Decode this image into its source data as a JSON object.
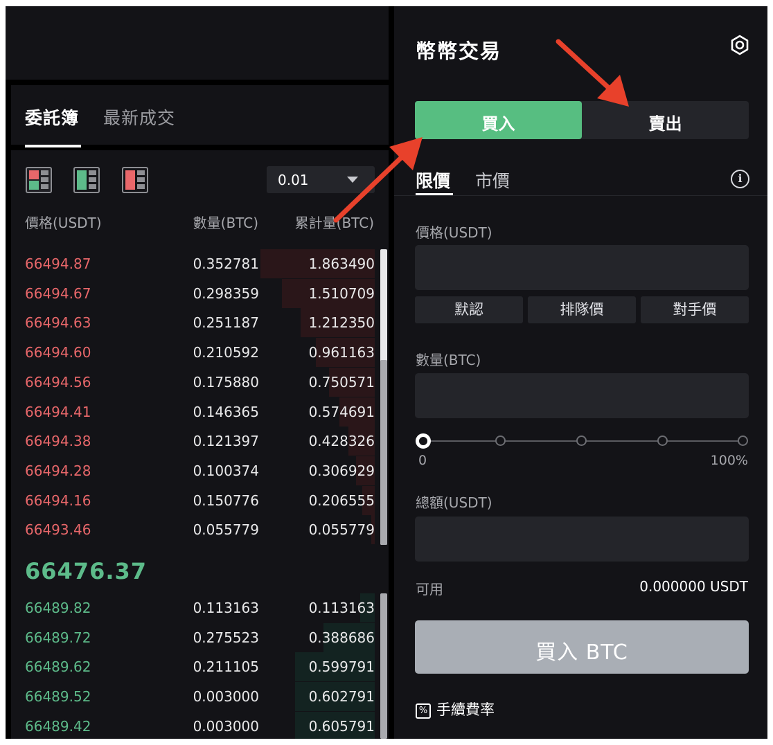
{
  "orderbook": {
    "tabs": [
      "委託簿",
      "最新成交"
    ],
    "tick_size": "0.01",
    "columns": [
      "價格(USDT)",
      "數量(BTC)",
      "累計量(BTC)"
    ],
    "asks": [
      {
        "price": "66494.87",
        "qty": "0.352781",
        "cum": "1.863490",
        "depth": 1.0
      },
      {
        "price": "66494.67",
        "qty": "0.298359",
        "cum": "1.510709",
        "depth": 0.811
      },
      {
        "price": "66494.63",
        "qty": "0.251187",
        "cum": "1.212350",
        "depth": 0.651
      },
      {
        "price": "66494.60",
        "qty": "0.210592",
        "cum": "0.961163",
        "depth": 0.516
      },
      {
        "price": "66494.56",
        "qty": "0.175880",
        "cum": "0.750571",
        "depth": 0.403
      },
      {
        "price": "66494.41",
        "qty": "0.146365",
        "cum": "0.574691",
        "depth": 0.308
      },
      {
        "price": "66494.38",
        "qty": "0.121397",
        "cum": "0.428326",
        "depth": 0.23
      },
      {
        "price": "66494.28",
        "qty": "0.100374",
        "cum": "0.306929",
        "depth": 0.165
      },
      {
        "price": "66494.16",
        "qty": "0.150776",
        "cum": "0.206555",
        "depth": 0.111
      },
      {
        "price": "66493.46",
        "qty": "0.055779",
        "cum": "0.055779",
        "depth": 0.03
      }
    ],
    "last_price": "66476.37",
    "bids": [
      {
        "price": "66489.82",
        "qty": "0.113163",
        "cum": "0.113163",
        "depth": 0.13
      },
      {
        "price": "66489.72",
        "qty": "0.275523",
        "cum": "0.388686",
        "depth": 0.45
      },
      {
        "price": "66489.62",
        "qty": "0.211105",
        "cum": "0.599791",
        "depth": 0.7
      },
      {
        "price": "66489.52",
        "qty": "0.003000",
        "cum": "0.602791",
        "depth": 0.7
      },
      {
        "price": "66489.42",
        "qty": "0.003000",
        "cum": "0.605791",
        "depth": 0.7
      }
    ],
    "colors": {
      "ask": "#e8676a",
      "bid": "#5dbb8a"
    }
  },
  "trade_panel": {
    "title": "幣幣交易",
    "buy_label": "買入",
    "sell_label": "賣出",
    "order_types": [
      "限價",
      "市價"
    ],
    "price_label": "價格(USDT)",
    "price_presets": [
      "默認",
      "排隊價",
      "對手價"
    ],
    "qty_label": "數量(BTC)",
    "slider_min": "0",
    "slider_max": "100%",
    "total_label": "總額(USDT)",
    "available_label": "可用",
    "available_value": "0.000000 USDT",
    "submit_label": "買入 BTC",
    "fee_label": "手續費率",
    "fee_icon_glyph": "%",
    "accent": "#57be81"
  }
}
